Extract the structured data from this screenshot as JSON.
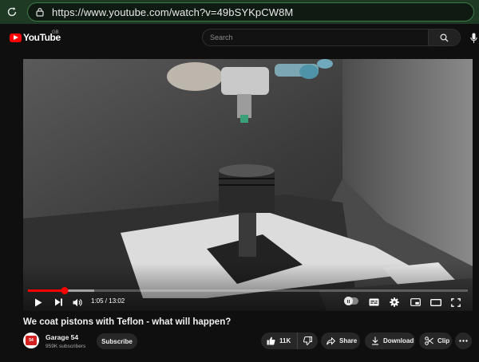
{
  "browser": {
    "url": "https://www.youtube.com/watch?v=49bSYKpCW8M"
  },
  "header": {
    "logo_text": "YouTube",
    "region": "GB",
    "search_placeholder": "Search"
  },
  "player": {
    "current_time": "1:05",
    "duration": "13:02",
    "time_display": "1:05 / 13:02",
    "progress_fraction": 0.083,
    "buffered_fraction": 0.15,
    "autoplay_on": false
  },
  "video": {
    "title": "We coat pistons with Teflon - what will happen?"
  },
  "channel": {
    "name": "Garage 54",
    "subscribers": "959K subscribers",
    "avatar_text": "54",
    "subscribe_label": "Subscribe"
  },
  "actions": {
    "like_count": "11K",
    "share_label": "Share",
    "download_label": "Download",
    "clip_label": "Clip"
  },
  "colors": {
    "brand_red": "#ff0000",
    "browser_bar": "#1f3a24",
    "page_bg": "#0f0f0f",
    "pill_bg": "#272727"
  },
  "icons": [
    "reload-icon",
    "lock-icon",
    "search-icon",
    "mic-icon",
    "play-icon",
    "next-icon",
    "volume-icon",
    "subtitles-icon",
    "settings-icon",
    "miniplayer-icon",
    "theater-icon",
    "fullscreen-icon",
    "thumbs-up-icon",
    "thumbs-down-icon",
    "share-icon",
    "download-icon",
    "scissors-icon",
    "more-icon"
  ]
}
